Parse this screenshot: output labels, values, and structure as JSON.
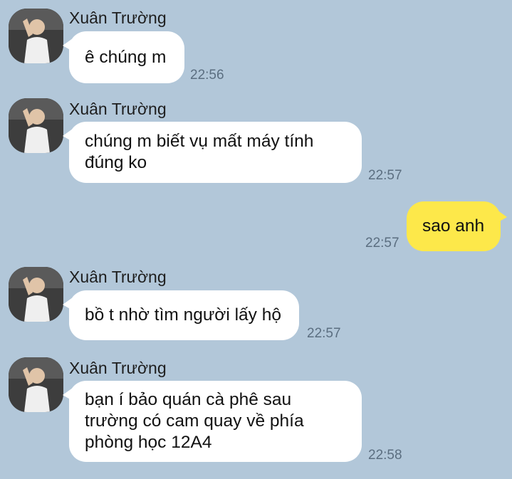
{
  "colors": {
    "background": "#b2c7d9",
    "incoming": "#ffffff",
    "outgoing": "#fde84a",
    "time": "#5b6e80"
  },
  "messages": [
    {
      "sender": "Xuân Trường",
      "lines": [
        "ê chúng m"
      ],
      "time": "22:56"
    },
    {
      "sender": "Xuân Trường",
      "lines": [
        "chúng m biết vụ mất máy tính",
        "đúng ko"
      ],
      "time": "22:57"
    },
    {
      "lines": [
        "sao anh"
      ],
      "time": "22:57"
    },
    {
      "sender": "Xuân Trường",
      "lines": [
        "bồ t nhờ tìm người lấy hộ"
      ],
      "time": "22:57"
    },
    {
      "sender": "Xuân Trường",
      "lines": [
        "bạn í bảo quán cà phê sau",
        "trường có cam quay về phía",
        "phòng học 12A4"
      ],
      "time": "22:58"
    }
  ]
}
